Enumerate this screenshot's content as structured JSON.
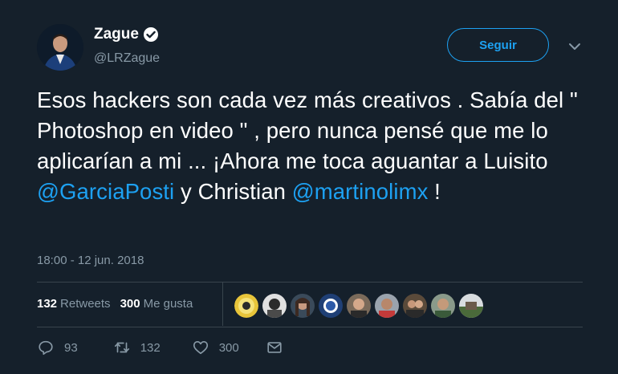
{
  "author": {
    "name": "Zague",
    "handle": "@LRZague"
  },
  "follow_label": "Seguir",
  "tweet": {
    "parts": [
      "Esos hackers son cada vez más creativos . Sabía del \" Photoshop en video \" , pero nunca pensé que me lo aplicarían a mi ... ¡Ahora me toca aguantar a Luisito ",
      "@GarciaPosti",
      " y Christian ",
      "@martinolimx",
      " !"
    ]
  },
  "timestamp": "18:00 - 12 jun. 2018",
  "stats": {
    "retweets_count": "132",
    "retweets_label": "Retweets",
    "likes_count": "300",
    "likes_label": "Me gusta"
  },
  "actions": {
    "reply_count": "93",
    "retweet_count": "132",
    "like_count": "300"
  },
  "colors": {
    "background": "#15202b",
    "accent": "#1da1f2",
    "muted": "#8899a6",
    "divider": "#38444d"
  }
}
